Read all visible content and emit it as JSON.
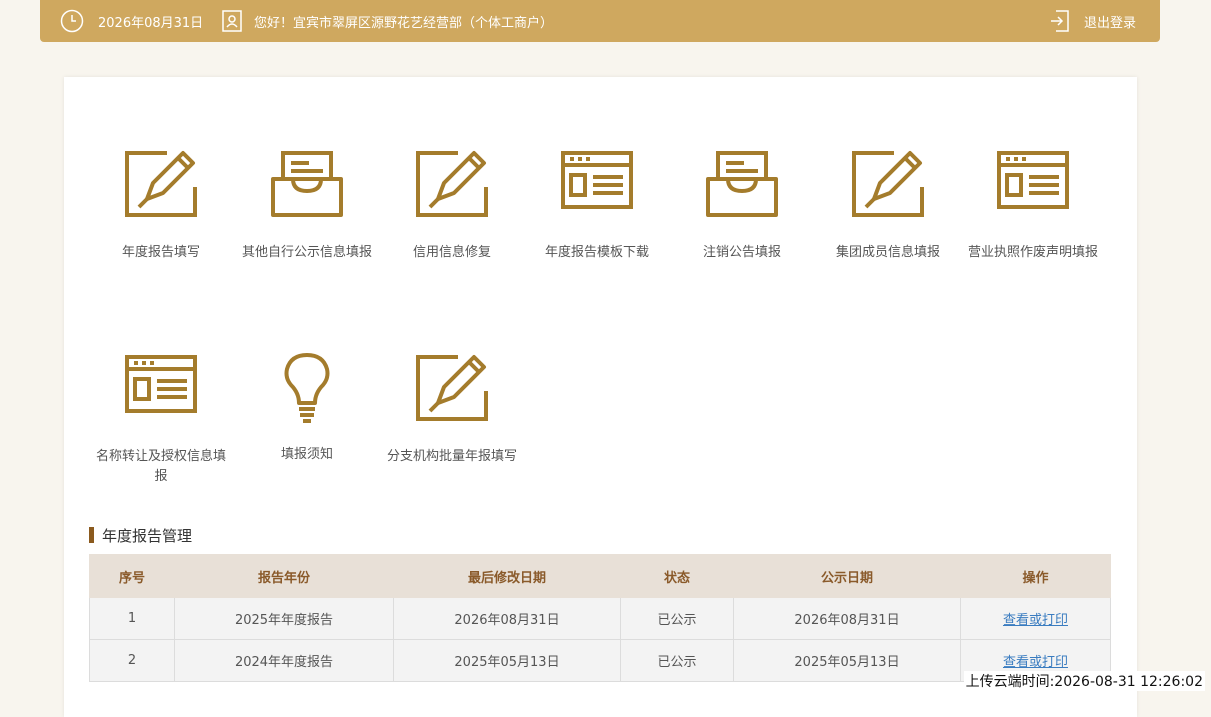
{
  "topbar": {
    "date": "2026年08月31日",
    "greeting": "您好！宜宾市翠屏区源野花艺经营部（个体工商户）",
    "logout": "退出登录"
  },
  "tiles": [
    {
      "label": "年度报告填写",
      "icon": "edit-pencil-icon"
    },
    {
      "label": "其他自行公示信息填报",
      "icon": "inbox-document-icon"
    },
    {
      "label": "信用信息修复",
      "icon": "edit-pencil-icon"
    },
    {
      "label": "年度报告模板下载",
      "icon": "browser-window-icon"
    },
    {
      "label": "注销公告填报",
      "icon": "inbox-document-icon"
    },
    {
      "label": "集团成员信息填报",
      "icon": "edit-pencil-icon"
    },
    {
      "label": "营业执照作废声明填报",
      "icon": "browser-window-icon"
    },
    {
      "label": "名称转让及授权信息填报",
      "icon": "browser-window-icon"
    },
    {
      "label": "填报须知",
      "icon": "lightbulb-icon"
    },
    {
      "label": "分支机构批量年报填写",
      "icon": "edit-pencil-icon"
    }
  ],
  "section": {
    "title": "年度报告管理"
  },
  "table": {
    "headers": [
      "序号",
      "报告年份",
      "最后修改日期",
      "状态",
      "公示日期",
      "操作"
    ],
    "rows": [
      {
        "no": "1",
        "year": "2025年年度报告",
        "modified": "2026年08月31日",
        "status": "已公示",
        "published": "2026年08月31日",
        "action": "查看或打印"
      },
      {
        "no": "2",
        "year": "2024年年度报告",
        "modified": "2025年05月13日",
        "status": "已公示",
        "published": "2025年05月13日",
        "action": "查看或打印"
      }
    ]
  },
  "watermark": "上传云端时间:2026-08-31 12:26:02",
  "colors": {
    "accent": "#cfa85f",
    "icon": "#a47c2c",
    "header_bg": "#e8e0d7",
    "link": "#3a7cc0"
  }
}
